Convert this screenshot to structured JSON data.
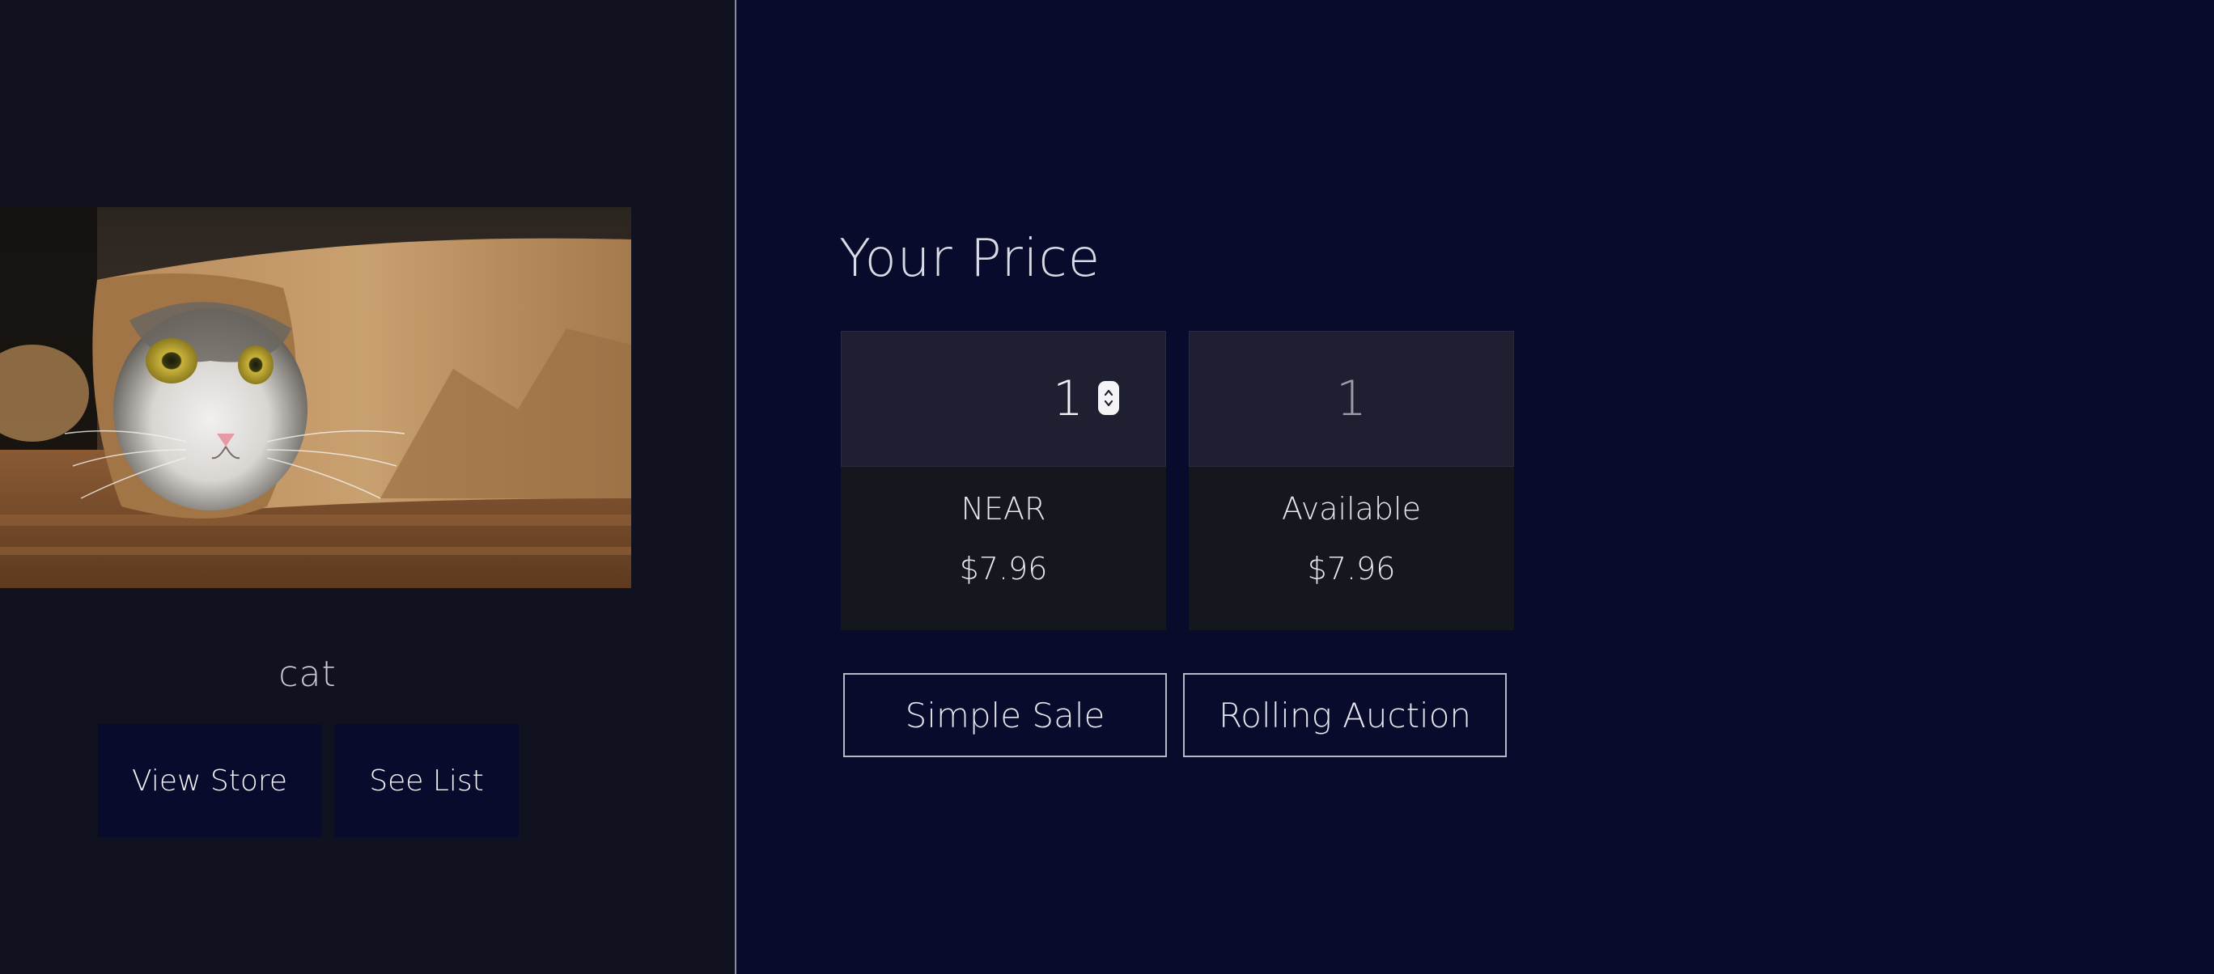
{
  "nft": {
    "name": "cat",
    "image_alt": "cat"
  },
  "left_actions": {
    "view_store": "View Store",
    "see_list": "See List"
  },
  "pricing": {
    "heading": "Your Price",
    "near_card": {
      "amount": "1",
      "label": "NEAR",
      "value": "$7.96"
    },
    "available_card": {
      "amount": "1",
      "label": "Available",
      "value": "$7.96"
    }
  },
  "sale_options": {
    "simple_sale": "Simple Sale",
    "rolling_auction": "Rolling Auction"
  },
  "colors": {
    "left_bg": "#10121f",
    "right_bg": "#080b2b",
    "card_top": "#1e2031",
    "card_bottom": "#15171f"
  }
}
